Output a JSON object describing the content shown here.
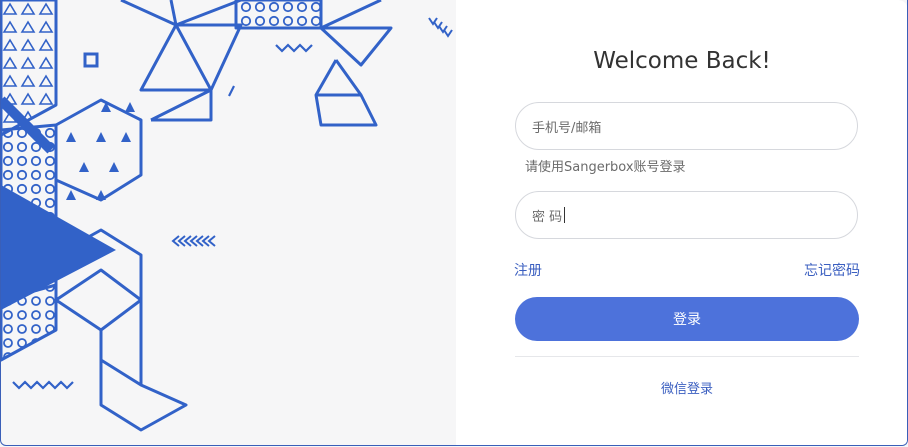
{
  "title": "Welcome Back!",
  "form": {
    "account_placeholder": "手机号/邮箱",
    "account_hint": "请使用Sangerbox账号登录",
    "password_placeholder": "密 码",
    "register_link": "注册",
    "forgot_link": "忘记密码",
    "login_button": "登录",
    "wechat_login": "微信登录"
  },
  "colors": {
    "accent": "#4d72db",
    "art_blue": "#3262c8",
    "panel_bg": "#ffffff",
    "page_bg": "#f6f6f7"
  }
}
